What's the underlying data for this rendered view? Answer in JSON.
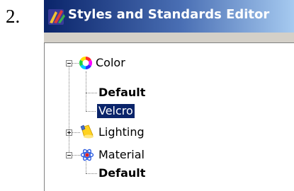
{
  "step_number": "2.",
  "window": {
    "title": "Styles and Standards Editor",
    "title_icon": "styles-editor-icon"
  },
  "tree": {
    "color": {
      "label": "Color",
      "icon": "color-wheel-icon",
      "expanded": true,
      "children": [
        {
          "label": "Default",
          "bold": true
        },
        {
          "label": "Velcro",
          "selected": true
        }
      ]
    },
    "lighting": {
      "label": "Lighting",
      "icon": "spotlight-icon",
      "expanded": false
    },
    "material": {
      "label": "Material",
      "icon": "material-atom-icon",
      "expanded": true,
      "children": [
        {
          "label": "Default",
          "bold": true
        }
      ]
    }
  },
  "colors": {
    "selection": "#0a246a",
    "title_start": "#0a246a",
    "title_end": "#a6caf0"
  }
}
